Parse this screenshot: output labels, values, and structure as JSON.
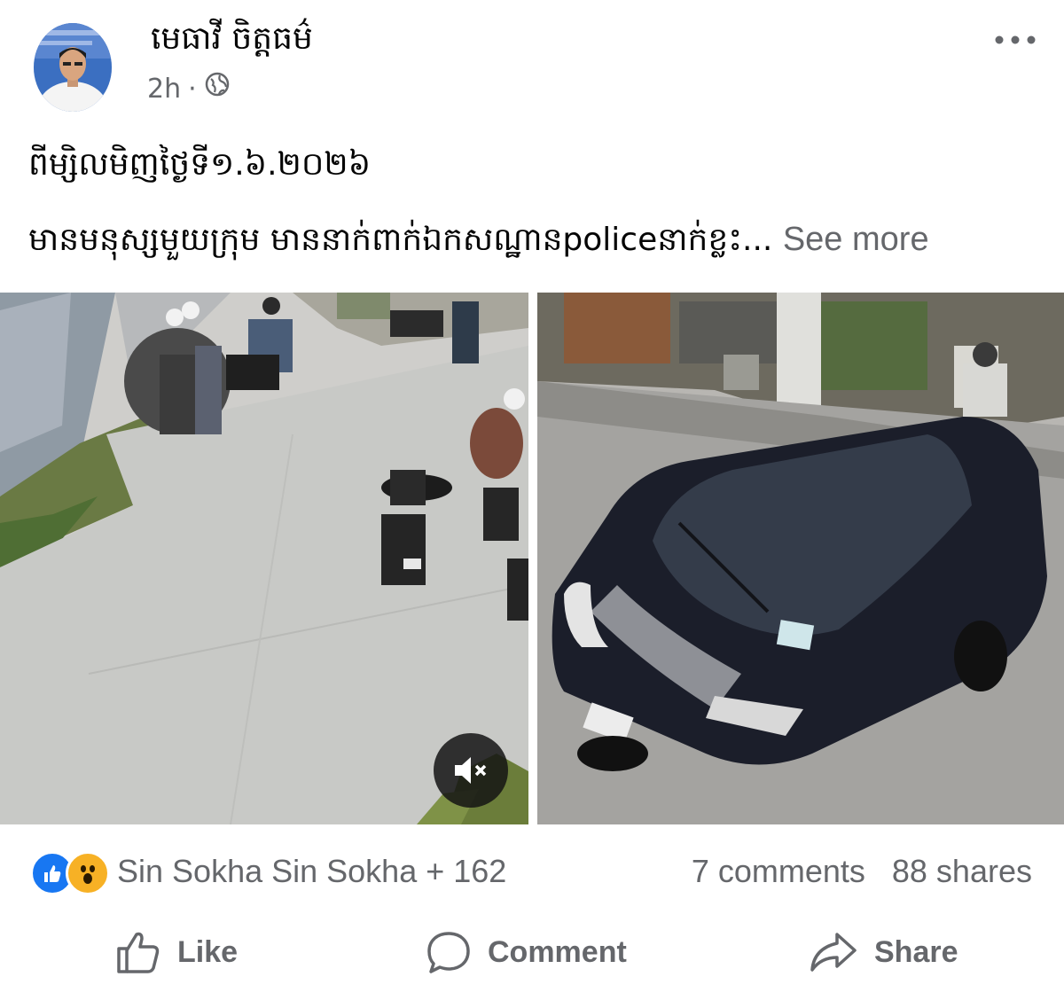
{
  "post": {
    "author": "មេធាវី ចិត្តធម៌",
    "time": "2h",
    "separator": "·",
    "privacy_icon": "globe-icon",
    "more_icon": "ellipsis-icon",
    "text_line1": "ពីម្សិលមិញថ្ងៃទី១.៦.២០២៦",
    "text_line2": "មានមនុស្សមួយក្រុម មាននាក់ពាក់ឯកសណ្ឋានpoliceនាក់ខ្លះ...",
    "see_more": "See more"
  },
  "media": {
    "left_kind": "video",
    "right_kind": "photo",
    "mute_icon": "speaker-muted-icon"
  },
  "stats": {
    "reaction_icons": [
      "like-reaction-icon",
      "wow-reaction-icon"
    ],
    "reactors": "Sin Sokha Sin Sokha + 162",
    "comments": "7 comments",
    "shares": "88 shares"
  },
  "actions": {
    "like": "Like",
    "comment": "Comment",
    "share": "Share"
  },
  "colors": {
    "like_blue": "#1877f2",
    "wow_yellow": "#f7b125",
    "secondary_text": "#65676b"
  }
}
